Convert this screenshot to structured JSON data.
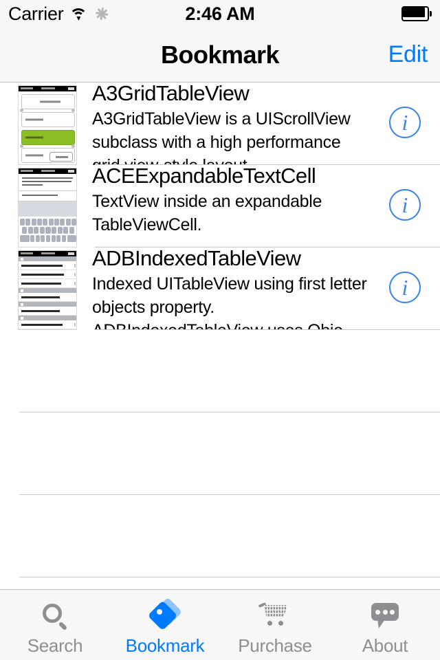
{
  "status_bar": {
    "carrier": "Carrier",
    "wifi_icon": "wifi-icon",
    "activity_icon": "activity-spinner-icon",
    "time": "2:46 AM",
    "battery_icon": "battery-full-icon"
  },
  "nav_bar": {
    "title": "Bookmark",
    "edit_label": "Edit",
    "accent_color": "#007AFF"
  },
  "list": {
    "rows": [
      {
        "title": "A3GridTableView",
        "detail": "A3GridTableView is a UIScrollView subclass with a high performance grid view-style layout.",
        "thumbnail": "grid-table-view-thumbnail",
        "accessory": "info-button"
      },
      {
        "title": "ACEExpandableTextCell",
        "detail": "TextView inside an expandable TableViewCell.",
        "thumbnail": "expandable-text-cell-thumbnail",
        "accessory": "info-button"
      },
      {
        "title": "ADBIndexedTableView",
        "detail": "Indexed UITableView using first letter objects property. ADBIndexedTableView uses Obje…",
        "thumbnail": "indexed-table-view-thumbnail",
        "accessory": "info-button"
      }
    ],
    "empty_rows": 3,
    "separator_color": "#c8c7cc",
    "info_button_color": "#3d84e6",
    "info_button_glyph": "i"
  },
  "tab_bar": {
    "items": [
      {
        "label": "Search",
        "icon": "search-icon",
        "active": false
      },
      {
        "label": "Bookmark",
        "icon": "tag-icon",
        "active": true
      },
      {
        "label": "Purchase",
        "icon": "cart-icon",
        "active": false
      },
      {
        "label": "About",
        "icon": "speech-bubble-icon",
        "active": false
      }
    ],
    "active_color": "#007AFF",
    "inactive_color": "#8E8E93"
  }
}
